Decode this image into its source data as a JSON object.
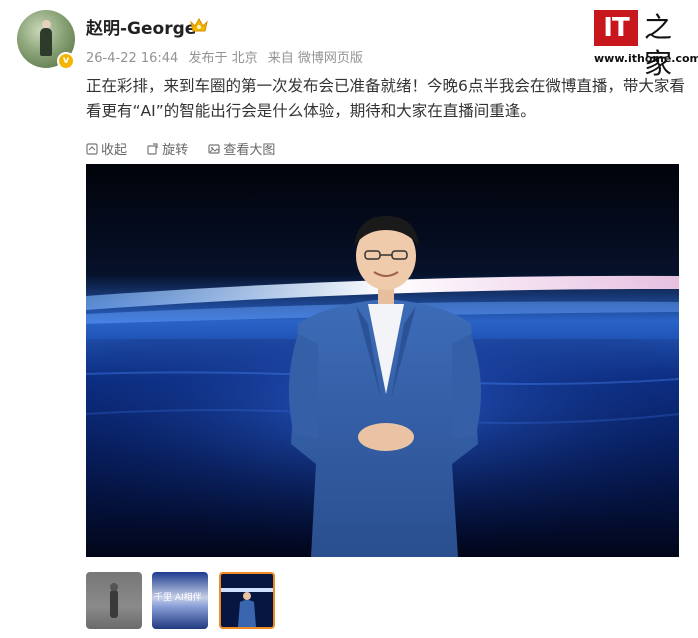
{
  "user": {
    "name": "赵明-George",
    "verified_badge": "v"
  },
  "meta": {
    "date": "26-4-22 16:44",
    "location": "发布于 北京",
    "source": "来自 微博网页版"
  },
  "logo": {
    "it": "IT",
    "zhi": "之家",
    "url": "www.ithome.com"
  },
  "post": {
    "text": "正在彩排，来到车圈的第一次发布会已准备就绪！今晚6点半我会在微博直播，带大家看看更有“AI”的智能出行会是什么体验，期待和大家在直播间重逢。"
  },
  "actions": {
    "collapse": "收起",
    "rotate": "旋转",
    "view_large": "查看大图"
  },
  "thumbnails": [
    {
      "label": ""
    },
    {
      "label": "千里  AI相伴"
    },
    {
      "label": ""
    }
  ],
  "colors": {
    "logo_red": "#c8161d",
    "badge_gold": "#f5b400",
    "selected_thumb_border": "#f08a24",
    "meta_gray": "#939393"
  }
}
